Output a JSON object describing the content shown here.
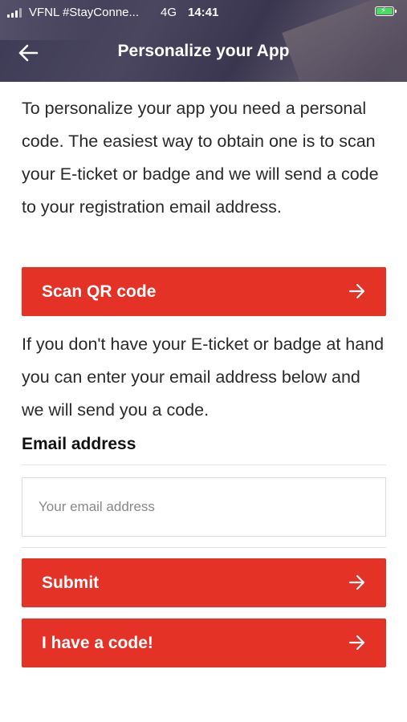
{
  "status_bar": {
    "carrier": "VFNL #StayConne...",
    "network": "4G",
    "time": "14:41"
  },
  "header": {
    "title": "Personalize your App"
  },
  "intro_text": "To personalize your app you need a personal code. The easiest way to obtain one is to scan your E-ticket or badge and we will send a code to your registration email address.",
  "scan_button": {
    "label": "Scan QR code"
  },
  "alt_text": "If you don't have your E-ticket or badge at hand you can enter your email address below and we will send you a code.",
  "email": {
    "label": "Email address",
    "value": "",
    "placeholder": "Your email address"
  },
  "submit_button": {
    "label": "Submit"
  },
  "code_button": {
    "label": "I have a code!"
  },
  "colors": {
    "accent": "#e53226",
    "header_bg": "#3d3a55",
    "battery": "#4cd964"
  }
}
